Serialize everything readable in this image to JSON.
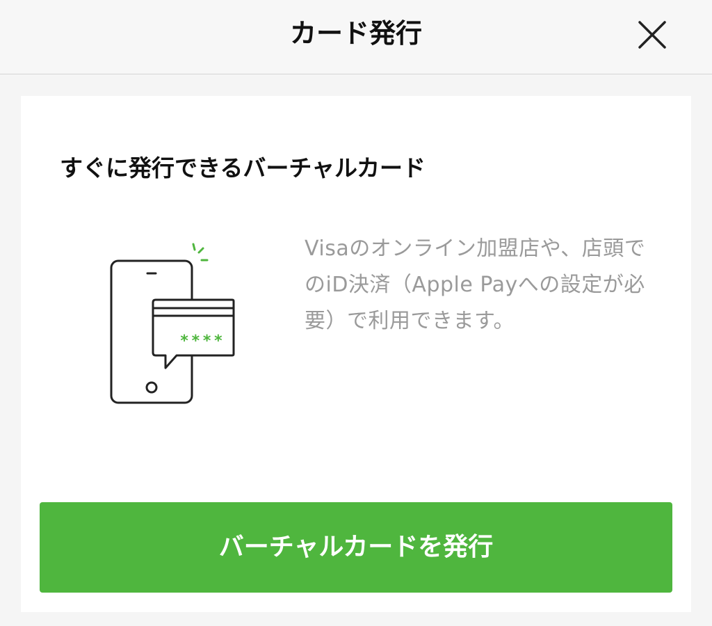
{
  "header": {
    "title": "カード発行",
    "close_icon": "close-icon"
  },
  "card": {
    "heading": "すぐに発行できるバーチャルカード",
    "illustration": {
      "icon": "phone-card-icon",
      "masked_number": "****"
    },
    "description": "Visaのオンライン加盟店や、店頭でのiD決済（Apple Payへの設定が必要）で利用できます。"
  },
  "actions": {
    "issue_label": "バーチャルカードを発行"
  },
  "colors": {
    "accent_green": "#4fb63e",
    "text_primary": "#111111",
    "text_secondary": "#9a9a9a",
    "background": "#f5f5f5"
  }
}
